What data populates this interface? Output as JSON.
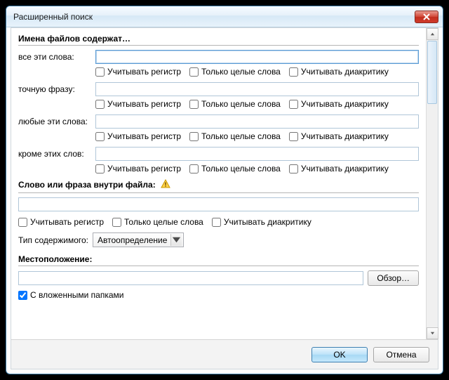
{
  "window": {
    "title": "Расширенный поиск"
  },
  "section1": {
    "heading": "Имена файлов содержат…",
    "rows": {
      "all": {
        "label": "все эти слова:"
      },
      "exact": {
        "label": "точную фразу:"
      },
      "any": {
        "label": "любые эти слова:"
      },
      "except": {
        "label": "кроме этих слов:"
      }
    }
  },
  "checks": {
    "case": "Учитывать регистр",
    "whole": "Только целые слова",
    "diacritics": "Учитывать диакритику"
  },
  "section2": {
    "heading": "Слово или фраза внутри файла:"
  },
  "contentType": {
    "label": "Тип содержимого:",
    "value": "Автоопределение"
  },
  "section3": {
    "heading": "Местоположение:",
    "browse": "Обзор…",
    "subfolders": "С вложенными папками"
  },
  "footer": {
    "ok": "OK",
    "cancel": "Отмена"
  }
}
